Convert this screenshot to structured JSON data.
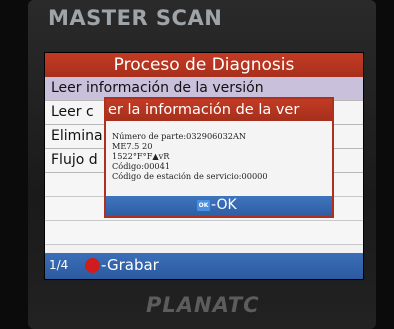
{
  "device": {
    "brand": "MASTER SCAN",
    "logo": "PLANATC"
  },
  "screen": {
    "title": "Proceso de Diagnosis",
    "menu": [
      {
        "label": "Leer información de la versión",
        "selected": true
      },
      {
        "label": "Leer c"
      },
      {
        "label": "Elimina"
      },
      {
        "label": "Flujo  d"
      }
    ],
    "status": {
      "page": "1/4",
      "record_label": "-Grabar",
      "record_icon": "red-circle"
    }
  },
  "dialog": {
    "title": "er la información de la ver",
    "lines": [
      "Número de parte:032906032AN",
      "ME7.5 20",
      "1522°F°F▲vR",
      "Código:00041",
      "Código de estación de servicio:00000"
    ],
    "ok_icon": "OK",
    "ok_label": "-OK"
  }
}
